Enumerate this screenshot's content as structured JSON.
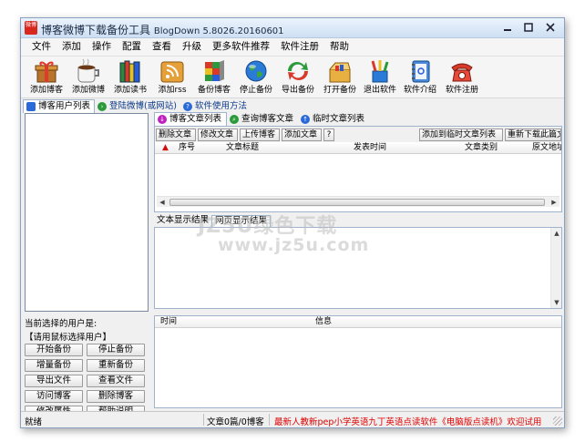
{
  "window": {
    "title": "博客微博下载备份工具",
    "version": "BlogDown 5.8026.20160601",
    "logo_text": "微博"
  },
  "menu": [
    "文件",
    "添加",
    "操作",
    "配置",
    "查看",
    "升级",
    "更多软件推荐",
    "软件注册",
    "帮助"
  ],
  "toolbar": [
    {
      "label": "添加博客",
      "icon": "gift-box-icon"
    },
    {
      "label": "添加微博",
      "icon": "coffee-mug-icon"
    },
    {
      "label": "添加读书",
      "icon": "books-icon"
    },
    {
      "label": "添加rss",
      "icon": "rss-folder-icon"
    },
    {
      "label": "备份博客",
      "icon": "cube-icon"
    },
    {
      "label": "停止备份",
      "icon": "globe-icon"
    },
    {
      "label": "导出备份",
      "icon": "export-arrows-icon"
    },
    {
      "label": "打开备份",
      "icon": "open-box-icon"
    },
    {
      "label": "退出软件",
      "icon": "pencil-cup-icon"
    },
    {
      "label": "软件介绍",
      "icon": "notebook-icon"
    },
    {
      "label": "软件注册",
      "icon": "telephone-icon"
    }
  ],
  "left_tabs": {
    "users": "博客用户列表",
    "login": "登陆微博(或网站)",
    "help": "软件使用方法"
  },
  "left_panel": {
    "current_user_label": "当前选择的用户是:",
    "select_hint": "【请用鼠标选择用户】",
    "buttons": [
      "开始备份",
      "停止备份",
      "增量备份",
      "重新备份",
      "导出文件",
      "查看文件",
      "访问博客",
      "删除博客",
      "修改属性",
      "帮助说明"
    ]
  },
  "right_tabs": {
    "articles": "博客文章列表",
    "query": "查询博客文章",
    "temp": "临时文章列表"
  },
  "article_toolbar": {
    "delete": "删除文章",
    "edit": "修改文章",
    "upload": "上传博客",
    "add": "添加文章",
    "help": "?",
    "add_temp": "添加到临时文章列表",
    "redownload": "重新下载此篇文"
  },
  "article_columns": [
    "序号",
    "文章标题",
    "发表时间",
    "文章类别",
    "原文地址"
  ],
  "text_tabs": {
    "text": "文本显示结果",
    "web": "网页显示结果"
  },
  "log_columns": [
    "时间",
    "信息"
  ],
  "status": {
    "ready": "就绪",
    "counts": "文章0篇/0博客",
    "promo": "最新人教新pep小学英语九丁英语点读软件《电脑版点读机》欢迎试用"
  },
  "watermark": {
    "line1": "JZ5U绿色下载",
    "line2": "www.jz5u.com"
  },
  "colors": {
    "accent": "#0c3a8a",
    "promo": "#e00000",
    "sort_arrow": "#d01010"
  }
}
